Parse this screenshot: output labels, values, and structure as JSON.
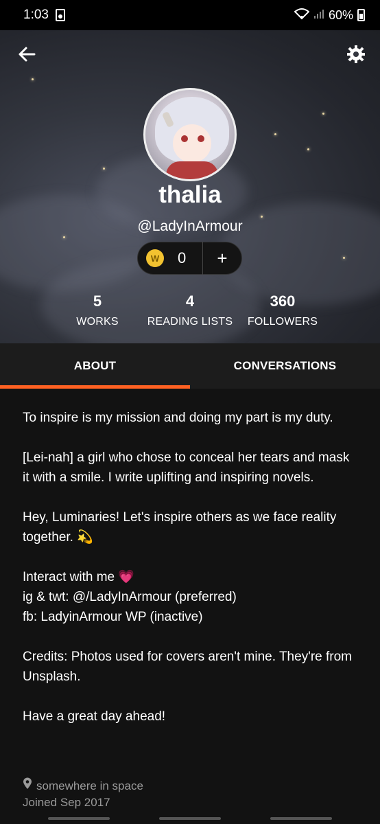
{
  "status_bar": {
    "time": "1:03",
    "battery": "60%"
  },
  "header": {
    "back_icon": "arrow-left-icon",
    "settings_icon": "gear-icon",
    "name": "thalia",
    "handle": "@LadyInArmour",
    "coins": "0",
    "coins_add": "+"
  },
  "stats": [
    {
      "value": "5",
      "label": "WORKS"
    },
    {
      "value": "4",
      "label": "READING LISTS"
    },
    {
      "value": "360",
      "label": "FOLLOWERS"
    }
  ],
  "tabs": [
    {
      "label": "ABOUT",
      "active": true
    },
    {
      "label": "CONVERSATIONS",
      "active": false
    }
  ],
  "about": {
    "p1": "To inspire is my mission and doing my part is my duty.",
    "p2": "[Lei-nah] a girl who chose to conceal her tears and mask it with a smile. I write uplifting and inspiring novels.",
    "p3": "Hey, Luminaries! Let's inspire others as we face reality together. 💫",
    "p4_l1": "Interact with me 💗",
    "p4_l2": "ig & twt: @/LadyInArmour (preferred)",
    "p4_l3": "fb: LadyinArmour WP (inactive)",
    "p5": "Credits: Photos used for covers aren't mine. They're from Unsplash.",
    "p6": "Have a great day ahead!"
  },
  "meta": {
    "location": "somewhere in space",
    "joined": "Joined Sep 2017"
  },
  "colors": {
    "accent": "#ff6122",
    "coin": "#f2c230"
  }
}
